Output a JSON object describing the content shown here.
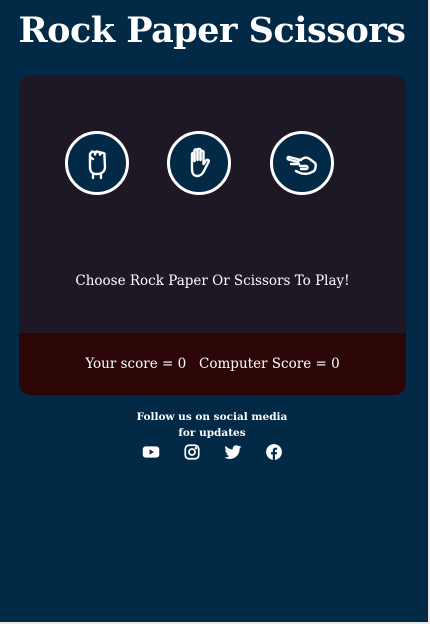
{
  "title": "Rock Paper Scissors",
  "choices": [
    {
      "label": "rock",
      "icon": "hand-fist-icon"
    },
    {
      "label": "paper",
      "icon": "hand-paper-icon"
    },
    {
      "label": "scissors",
      "icon": "hand-scissors-icon"
    }
  ],
  "prompt": "Choose Rock Paper Or Scissors To Play!",
  "score": {
    "player_label": "Your score = ",
    "player_value": "0",
    "computer_label": "Computer Score = ",
    "computer_value": "0"
  },
  "social": {
    "line1": "Follow us on social media",
    "line2": "for updates",
    "icons": [
      "youtube-icon",
      "instagram-icon",
      "twitter-icon",
      "facebook-icon"
    ]
  },
  "colors": {
    "background": "#022945",
    "card": "#1d1823",
    "score_bar": "#2c0606",
    "text": "#ffffff"
  }
}
